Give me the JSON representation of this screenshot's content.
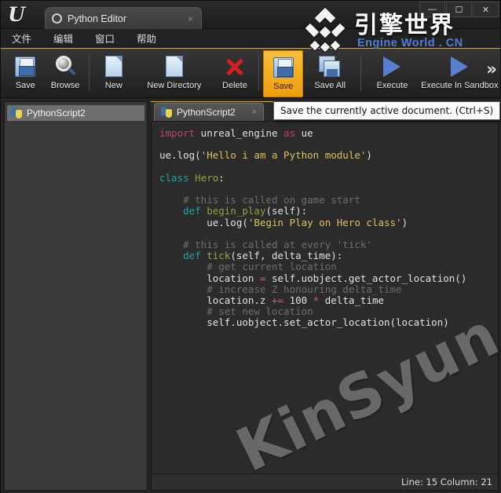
{
  "window": {
    "app_logo": "unreal-u-logo",
    "tab_title": "Python Editor",
    "tab_close": "×",
    "controls": [
      {
        "name": "minimize",
        "glyph": "—"
      },
      {
        "name": "maximize",
        "glyph": "☐"
      },
      {
        "name": "close",
        "glyph": "✕"
      }
    ]
  },
  "menubar": {
    "items": [
      {
        "name": "file",
        "label": "文件"
      },
      {
        "name": "edit",
        "label": "编辑"
      },
      {
        "name": "window",
        "label": "窗口"
      },
      {
        "name": "help",
        "label": "帮助"
      }
    ]
  },
  "toolbar": {
    "buttons": [
      {
        "name": "save",
        "label": "Save",
        "icon": "floppy-disk-icon",
        "active": false
      },
      {
        "name": "browse",
        "label": "Browse",
        "icon": "magnifier-icon",
        "active": false
      },
      {
        "name": "new",
        "label": "New",
        "icon": "document-icon",
        "active": false
      },
      {
        "name": "new-directory",
        "label": "New Directory",
        "icon": "document-icon",
        "active": false
      },
      {
        "name": "delete",
        "label": "Delete",
        "icon": "red-x-icon",
        "active": false
      },
      {
        "name": "save-active",
        "label": "Save",
        "icon": "floppy-disk-icon",
        "active": true
      },
      {
        "name": "save-all",
        "label": "Save All",
        "icon": "floppy-disk-stack-icon",
        "active": false
      },
      {
        "name": "execute",
        "label": "Execute",
        "icon": "play-triangle-icon",
        "active": false
      },
      {
        "name": "execute-in-sandbox",
        "label": "Execute In Sandbox",
        "icon": "play-triangle-icon",
        "active": false
      }
    ],
    "overflow_glyph": "»",
    "accent_color": "#f0a818"
  },
  "tooltip": {
    "text": "Save the currently active document. (Ctrl+S)"
  },
  "sidebar": {
    "items": [
      {
        "name": "pythonscript2",
        "label": "PythonScript2",
        "icon": "python-icon",
        "selected": true
      }
    ]
  },
  "editor": {
    "tabs": [
      {
        "name": "pythonscript2",
        "label": "PythonScript2",
        "icon": "python-icon",
        "close": "×",
        "active": true
      }
    ],
    "watermark": "KinSyun",
    "code_lines": [
      [
        {
          "t": "import",
          "c": "k-import"
        },
        {
          "t": " unreal_engine ",
          "c": "k-plain"
        },
        {
          "t": "as",
          "c": "k-import"
        },
        {
          "t": " ue",
          "c": "k-plain"
        }
      ],
      [],
      [
        {
          "t": "ue.log(",
          "c": "k-plain"
        },
        {
          "t": "'Hello i am a Python module'",
          "c": "k-str"
        },
        {
          "t": ")",
          "c": "k-plain"
        }
      ],
      [],
      [
        {
          "t": "class",
          "c": "k-kw"
        },
        {
          "t": " ",
          "c": "k-plain"
        },
        {
          "t": "Hero",
          "c": "k-fn"
        },
        {
          "t": ":",
          "c": "k-plain"
        }
      ],
      [],
      [
        {
          "t": "    # this is called on game start",
          "c": "k-cmt"
        }
      ],
      [
        {
          "t": "    ",
          "c": "k-plain"
        },
        {
          "t": "def",
          "c": "k-kw"
        },
        {
          "t": " ",
          "c": "k-plain"
        },
        {
          "t": "begin_play",
          "c": "k-fn"
        },
        {
          "t": "(self):",
          "c": "k-plain"
        }
      ],
      [
        {
          "t": "        ue.log(",
          "c": "k-plain"
        },
        {
          "t": "'Begin Play on Hero class'",
          "c": "k-str"
        },
        {
          "t": ")",
          "c": "k-plain"
        }
      ],
      [],
      [
        {
          "t": "    # this is called at every 'tick'",
          "c": "k-cmt"
        }
      ],
      [
        {
          "t": "    ",
          "c": "k-plain"
        },
        {
          "t": "def",
          "c": "k-kw"
        },
        {
          "t": " ",
          "c": "k-plain"
        },
        {
          "t": "tick",
          "c": "k-fn"
        },
        {
          "t": "(self, delta_time):",
          "c": "k-plain"
        }
      ],
      [
        {
          "t": "        # get current location",
          "c": "k-cmt"
        }
      ],
      [
        {
          "t": "        location ",
          "c": "k-plain"
        },
        {
          "t": "=",
          "c": "k-op"
        },
        {
          "t": " self.uobject.get_actor_location()",
          "c": "k-plain"
        }
      ],
      [
        {
          "t": "        # increase Z honouring delta_time",
          "c": "k-cmt"
        }
      ],
      [
        {
          "t": "        location.z ",
          "c": "k-plain"
        },
        {
          "t": "+=",
          "c": "k-op"
        },
        {
          "t": " ",
          "c": "k-plain"
        },
        {
          "t": "100",
          "c": "k-num"
        },
        {
          "t": " ",
          "c": "k-plain"
        },
        {
          "t": "*",
          "c": "k-op"
        },
        {
          "t": " delta_time",
          "c": "k-plain"
        }
      ],
      [
        {
          "t": "        # set new location",
          "c": "k-cmt"
        }
      ],
      [
        {
          "t": "        self.uobject.set_actor_location(location)",
          "c": "k-plain"
        }
      ]
    ]
  },
  "statusbar": {
    "text": "Line: 15 Column: 21",
    "line": 15,
    "column": 21
  },
  "brand_watermark": {
    "chinese": "引擎世界",
    "english": "Engine World . CN",
    "english_color": "#4d7fd6"
  }
}
